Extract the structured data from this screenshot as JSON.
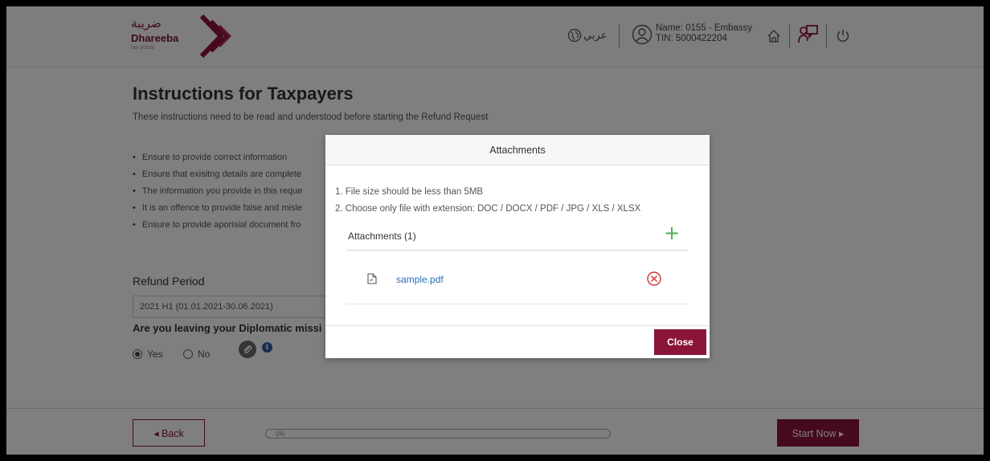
{
  "header": {
    "logo_arabic": "ضريبة",
    "logo_name": "Dhareeba",
    "logo_sub": "tax portal",
    "language_label": "عربي",
    "user_name": "Name: 0155 - Embassy",
    "user_tin": "TIN: 5000422204"
  },
  "page": {
    "title": "Instructions for Taxpayers",
    "subtitle": "These instructions need to be read and understood before starting the Refund Request",
    "bullets": [
      "Ensure to provide correct information",
      "Ensure that exisitng details are complete",
      "The information you provide in this reque",
      "It is an offence to provide false and misle",
      "Ensure to provide aporisial document fro"
    ],
    "refund_period_label": "Refund Period",
    "refund_period_value": "2021 H1 (01.01.2021-30.06.2021)",
    "diplomatic_question": "Are you leaving your Diplomatic missi",
    "radio_yes": "Yes",
    "radio_no": "No",
    "yes_selected": true
  },
  "footer": {
    "back_label": "◂  Back",
    "progress_text": "0%",
    "progress_value": 0,
    "start_label": "Start Now  ▸"
  },
  "modal": {
    "title": "Attachments",
    "rule1": "1. File size should be less than 5MB",
    "rule2": "2. Choose only file with extension: DOC / DOCX / PDF / JPG / XLS / XLSX",
    "attachments_title": "Attachments (1)",
    "files": [
      {
        "name": "sample.pdf"
      }
    ],
    "close_label": "Close"
  },
  "colors": {
    "brand": "#8a1538",
    "add": "#4caf50",
    "remove": "#d32f2f",
    "link": "#2a6fb8"
  }
}
